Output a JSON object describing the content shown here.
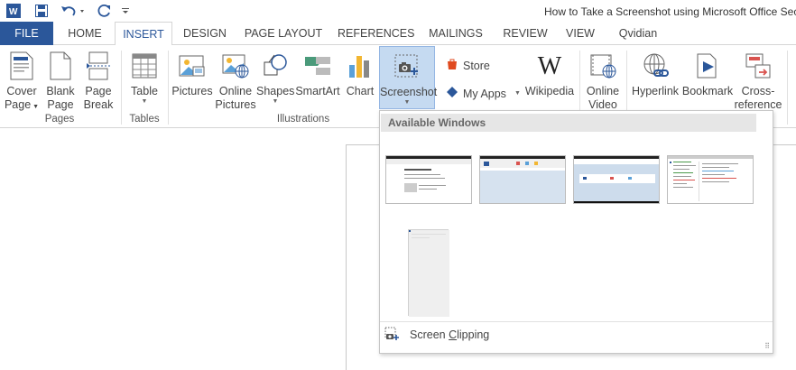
{
  "title_bar": {
    "document_title": "How to Take a Screenshot using Microsoft Office Sec",
    "qat": {
      "app_icon": "word-icon",
      "save_icon": "save-icon",
      "undo_icon": "undo-icon",
      "redo_icon": "redo-icon",
      "customize_icon": "customize-qat-icon"
    }
  },
  "tabs": [
    {
      "label": "FILE"
    },
    {
      "label": "HOME"
    },
    {
      "label": "INSERT"
    },
    {
      "label": "DESIGN"
    },
    {
      "label": "PAGE LAYOUT"
    },
    {
      "label": "REFERENCES"
    },
    {
      "label": "MAILINGS"
    },
    {
      "label": "REVIEW"
    },
    {
      "label": "VIEW"
    },
    {
      "label": "Qvidian"
    }
  ],
  "active_tab": "INSERT",
  "ribbon": {
    "pages": {
      "label": "Pages",
      "cover_page": {
        "line1": "Cover",
        "line2": "Page"
      },
      "blank_page": {
        "line1": "Blank",
        "line2": "Page"
      },
      "page_break": {
        "line1": "Page",
        "line2": "Break"
      }
    },
    "tables": {
      "label": "Tables",
      "table": "Table"
    },
    "illustrations": {
      "label": "Illustrations",
      "pictures": "Pictures",
      "online_pictures": {
        "line1": "Online",
        "line2": "Pictures"
      },
      "shapes": "Shapes",
      "smartart": "SmartArt",
      "chart": "Chart",
      "screenshot": "Screenshot"
    },
    "apps": {
      "store": "Store",
      "my_apps": "My Apps",
      "wikipedia": "Wikipedia"
    },
    "media": {
      "online_video": {
        "line1": "Online",
        "line2": "Video"
      }
    },
    "links": {
      "hyperlink": "Hyperlink",
      "bookmark": "Bookmark",
      "cross_reference": {
        "line1": "Cross-",
        "line2": "reference"
      }
    }
  },
  "screenshot_menu": {
    "header": "Available Windows",
    "windows_count": 5,
    "screen_clipping_prefix": "Screen ",
    "screen_clipping_accel": "C",
    "screen_clipping_suffix": "lipping"
  },
  "colors": {
    "file_tab": "#2b579a",
    "accent": "#2b579a",
    "selected_button": "#c5daf1"
  }
}
